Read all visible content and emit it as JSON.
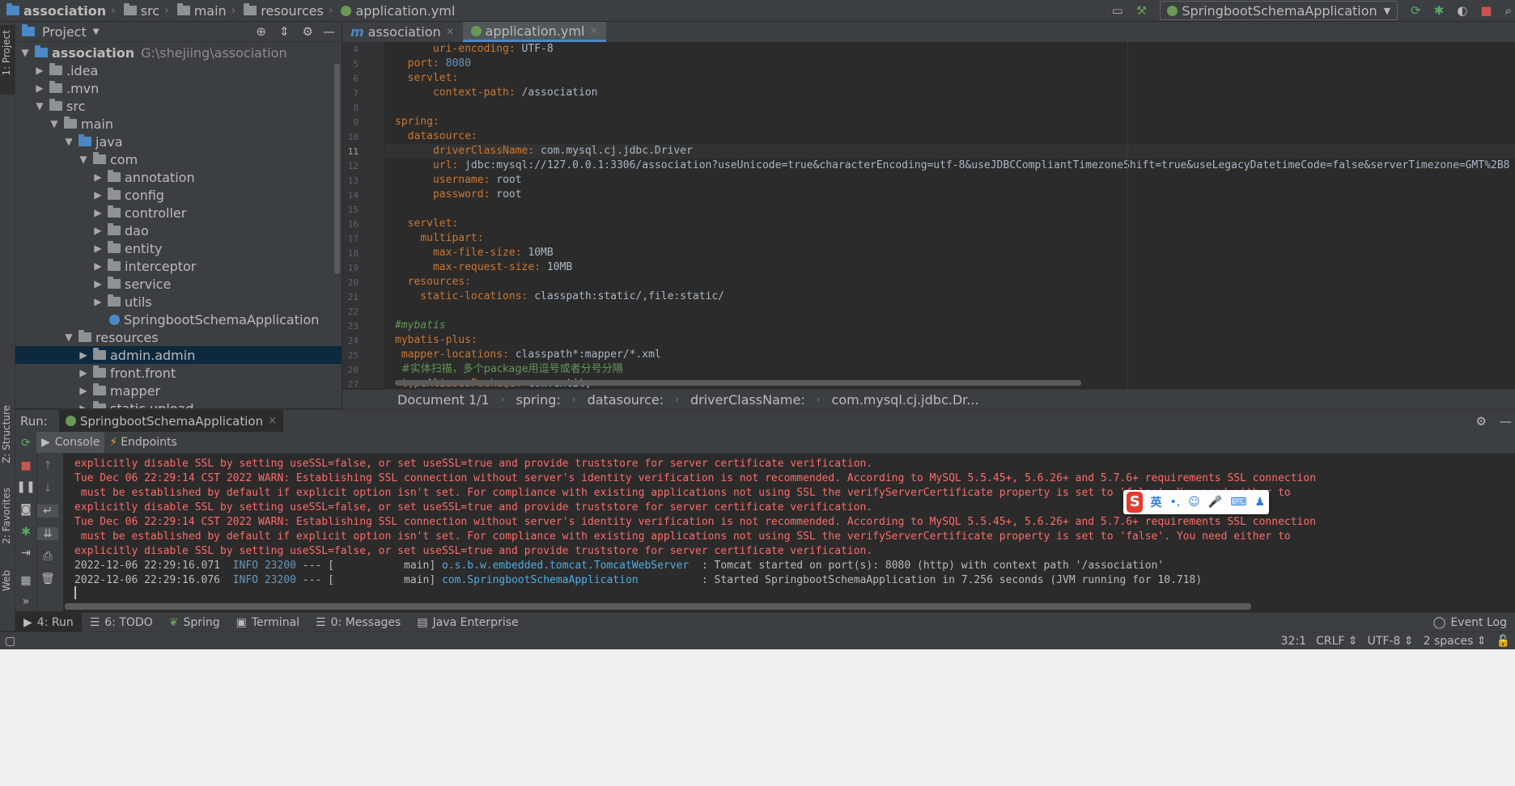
{
  "navbar": {
    "crumbs": [
      "association",
      "src",
      "main",
      "resources",
      "application.yml"
    ],
    "run_config": "SpringbootSchemaApplication"
  },
  "left_stripe": {
    "project": "1: Project",
    "structure": "Z: Structure",
    "favorites": "2: Favorites",
    "web": "Web"
  },
  "project": {
    "title": "Project",
    "root_name": "association",
    "root_path": "G:\\shejiing\\association",
    "items": [
      {
        "label": ".idea"
      },
      {
        "label": ".mvn"
      },
      {
        "label": "src"
      },
      {
        "label": "main"
      },
      {
        "label": "java"
      },
      {
        "label": "com"
      },
      {
        "label": "annotation"
      },
      {
        "label": "config"
      },
      {
        "label": "controller"
      },
      {
        "label": "dao"
      },
      {
        "label": "entity"
      },
      {
        "label": "interceptor"
      },
      {
        "label": "service"
      },
      {
        "label": "utils"
      },
      {
        "label": "SpringbootSchemaApplication"
      },
      {
        "label": "resources"
      },
      {
        "label": "admin.admin"
      },
      {
        "label": "front.front"
      },
      {
        "label": "mapper"
      },
      {
        "label": "static.upload"
      }
    ]
  },
  "editor": {
    "tabs": [
      {
        "label": "association"
      },
      {
        "label": "application.yml"
      }
    ],
    "line_numbers": [
      "4",
      "5",
      "6",
      "7",
      "8",
      "9",
      "10",
      "11",
      "12",
      "13",
      "14",
      "15",
      "16",
      "17",
      "18",
      "19",
      "20",
      "21",
      "22",
      "23",
      "24",
      "25",
      "26",
      "27"
    ],
    "lines": [
      {
        "indent": "      ",
        "key": "uri-encoding",
        "value": "UTF-8"
      },
      {
        "indent": "  ",
        "key": "port",
        "value": "8080"
      },
      {
        "indent": "  ",
        "key": "servlet",
        "value": ""
      },
      {
        "indent": "      ",
        "key": "context-path",
        "value": "/association"
      },
      {
        "indent": "",
        "key": "",
        "value": ""
      },
      {
        "indent": "",
        "key": "spring",
        "value": ""
      },
      {
        "indent": "  ",
        "key": "datasource",
        "value": ""
      },
      {
        "indent": "      ",
        "key": "driverClassName",
        "value": "com.mysql.cj.jdbc.Driver"
      },
      {
        "indent": "      ",
        "key": "url",
        "value": "jdbc:mysql://127.0.0.1:3306/association?useUnicode=true&characterEncoding=utf-8&useJDBCCompliantTimezoneShift=true&useLegacyDatetimeCode=false&serverTimezone=GMT%2B8"
      },
      {
        "indent": "      ",
        "key": "username",
        "value": "root"
      },
      {
        "indent": "      ",
        "key": "password",
        "value": "root"
      },
      {
        "indent": "",
        "key": "",
        "value": ""
      },
      {
        "indent": "  ",
        "key": "servlet",
        "value": ""
      },
      {
        "indent": "    ",
        "key": "multipart",
        "value": ""
      },
      {
        "indent": "      ",
        "key": "max-file-size",
        "value": "10MB"
      },
      {
        "indent": "      ",
        "key": "max-request-size",
        "value": "10MB"
      },
      {
        "indent": "  ",
        "key": "resources",
        "value": ""
      },
      {
        "indent": "    ",
        "key": "static-locations",
        "value": "classpath:static/,file:static/"
      },
      {
        "indent": "",
        "key": "",
        "value": ""
      },
      {
        "indent": "",
        "comment": "#mybatis"
      },
      {
        "indent": "",
        "key": "mybatis-plus",
        "value": ""
      },
      {
        "indent": " ",
        "key": "mapper-locations",
        "value": "classpath*:mapper/*.xml"
      },
      {
        "indent": " ",
        "comment_zh": "#实体扫描，多个package用逗号或者分号分隔"
      },
      {
        "indent": " ",
        "key": "typeAliasesPackage",
        "value": "com.entity"
      }
    ],
    "breadcrumb": [
      "Document 1/1",
      "spring:",
      "datasource:",
      "driverClassName:",
      "com.mysql.cj.jdbc.Dr..."
    ]
  },
  "run": {
    "label": "Run:",
    "tab": "SpringbootSchemaApplication",
    "subtabs": [
      "Console",
      "Endpoints"
    ],
    "console": [
      {
        "cls": "red",
        "text": "explicitly disable SSL by setting useSSL=false, or set useSSL=true and provide truststore for server certificate verification."
      },
      {
        "cls": "red",
        "text": "Tue Dec 06 22:29:14 CST 2022 WARN: Establishing SSL connection without server's identity verification is not recommended. According to MySQL 5.5.45+, 5.6.26+ and 5.7.6+ requirements SSL connection"
      },
      {
        "cls": "red",
        "text": " must be established by default if explicit option isn't set. For compliance with existing applications not using SSL the verifyServerCertificate property is set to 'false'. You need either to"
      },
      {
        "cls": "red",
        "text": "explicitly disable SSL by setting useSSL=false, or set useSSL=true and provide truststore for server certificate verification."
      },
      {
        "cls": "red",
        "text": "Tue Dec 06 22:29:14 CST 2022 WARN: Establishing SSL connection without server's identity verification is not recommended. According to MySQL 5.5.45+, 5.6.26+ and 5.7.6+ requirements SSL connection"
      },
      {
        "cls": "red",
        "text": " must be established by default if explicit option isn't set. For compliance with existing applications not using SSL the verifyServerCertificate property is set to 'false'. You need either to"
      },
      {
        "cls": "red",
        "text": "explicitly disable SSL by setting useSSL=false, or set useSSL=true and provide truststore for server certificate verification."
      }
    ],
    "log": [
      {
        "time": "2022-12-06 22:29:16.071",
        "level": "INFO",
        "pid": "23200",
        "sep": "--- [           main]",
        "logger": "o.s.b.w.embedded.tomcat.TomcatWebServer ",
        "msg": ": Tomcat started on port(s): 8080 (http) with context path '/association'"
      },
      {
        "time": "2022-12-06 22:29:16.076",
        "level": "INFO",
        "pid": "23200",
        "sep": "--- [           main]",
        "logger": "com.SpringbootSchemaApplication         ",
        "msg": ": Started SpringbootSchemaApplication in 7.256 seconds (JVM running for 10.718)"
      }
    ]
  },
  "ime": {
    "lang": "英"
  },
  "bottom_tabs": [
    {
      "label": "4: Run"
    },
    {
      "label": "6: TODO"
    },
    {
      "label": "Spring"
    },
    {
      "label": "Terminal"
    },
    {
      "label": "0: Messages"
    },
    {
      "label": "Java Enterprise"
    }
  ],
  "event_log": "Event Log",
  "status": {
    "position": "32:1",
    "line_sep": "CRLF",
    "encoding": "UTF-8",
    "indent": "2 spaces"
  },
  "colors": {
    "accent": "#4a88c7",
    "selection": "#0d293e",
    "error_text": "#ff6b68",
    "yaml_key": "#cc7832"
  }
}
